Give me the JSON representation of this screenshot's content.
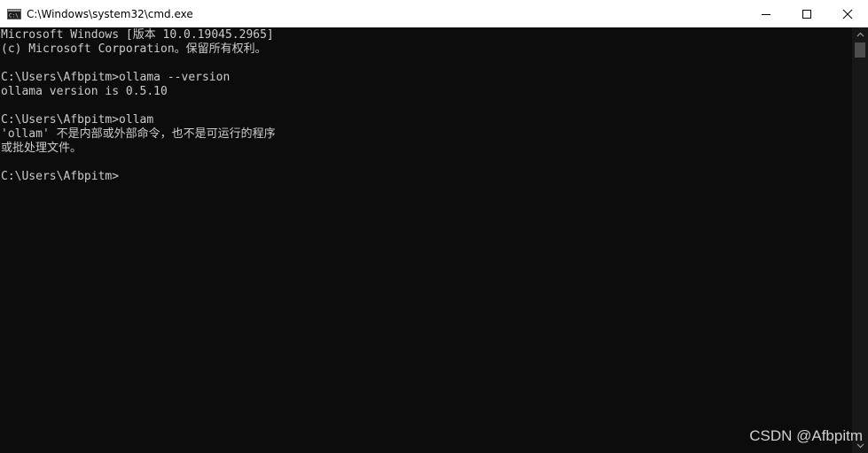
{
  "window": {
    "title": "C:\\Windows\\system32\\cmd.exe",
    "icon": "cmd-icon",
    "controls": {
      "minimize_icon": "minimize-icon",
      "maximize_icon": "maximize-icon",
      "close_icon": "close-icon"
    }
  },
  "console": {
    "text_color": "#cccccc",
    "background": "#0c0c0c",
    "lines": [
      "Microsoft Windows [版本 10.0.19045.2965]",
      "(c) Microsoft Corporation。保留所有权利。",
      "",
      "C:\\Users\\Afbpitm>ollama --version",
      "ollama version is 0.5.10",
      "",
      "C:\\Users\\Afbpitm>ollam",
      "'ollam' 不是内部或外部命令，也不是可运行的程序",
      "或批处理文件。",
      "",
      "C:\\Users\\Afbpitm>"
    ]
  },
  "watermark": "CSDN @Afbpitm"
}
